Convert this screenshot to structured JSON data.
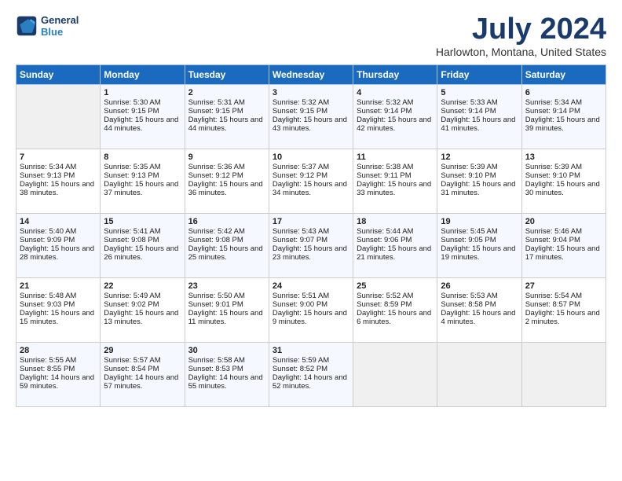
{
  "header": {
    "logo_line1": "General",
    "logo_line2": "Blue",
    "month_title": "July 2024",
    "location": "Harlowton, Montana, United States"
  },
  "days_of_week": [
    "Sunday",
    "Monday",
    "Tuesday",
    "Wednesday",
    "Thursday",
    "Friday",
    "Saturday"
  ],
  "weeks": [
    [
      {
        "day": "",
        "sunrise": "",
        "sunset": "",
        "daylight": ""
      },
      {
        "day": "1",
        "sunrise": "Sunrise: 5:30 AM",
        "sunset": "Sunset: 9:15 PM",
        "daylight": "Daylight: 15 hours and 44 minutes."
      },
      {
        "day": "2",
        "sunrise": "Sunrise: 5:31 AM",
        "sunset": "Sunset: 9:15 PM",
        "daylight": "Daylight: 15 hours and 44 minutes."
      },
      {
        "day": "3",
        "sunrise": "Sunrise: 5:32 AM",
        "sunset": "Sunset: 9:15 PM",
        "daylight": "Daylight: 15 hours and 43 minutes."
      },
      {
        "day": "4",
        "sunrise": "Sunrise: 5:32 AM",
        "sunset": "Sunset: 9:14 PM",
        "daylight": "Daylight: 15 hours and 42 minutes."
      },
      {
        "day": "5",
        "sunrise": "Sunrise: 5:33 AM",
        "sunset": "Sunset: 9:14 PM",
        "daylight": "Daylight: 15 hours and 41 minutes."
      },
      {
        "day": "6",
        "sunrise": "Sunrise: 5:34 AM",
        "sunset": "Sunset: 9:14 PM",
        "daylight": "Daylight: 15 hours and 39 minutes."
      }
    ],
    [
      {
        "day": "7",
        "sunrise": "Sunrise: 5:34 AM",
        "sunset": "Sunset: 9:13 PM",
        "daylight": "Daylight: 15 hours and 38 minutes."
      },
      {
        "day": "8",
        "sunrise": "Sunrise: 5:35 AM",
        "sunset": "Sunset: 9:13 PM",
        "daylight": "Daylight: 15 hours and 37 minutes."
      },
      {
        "day": "9",
        "sunrise": "Sunrise: 5:36 AM",
        "sunset": "Sunset: 9:12 PM",
        "daylight": "Daylight: 15 hours and 36 minutes."
      },
      {
        "day": "10",
        "sunrise": "Sunrise: 5:37 AM",
        "sunset": "Sunset: 9:12 PM",
        "daylight": "Daylight: 15 hours and 34 minutes."
      },
      {
        "day": "11",
        "sunrise": "Sunrise: 5:38 AM",
        "sunset": "Sunset: 9:11 PM",
        "daylight": "Daylight: 15 hours and 33 minutes."
      },
      {
        "day": "12",
        "sunrise": "Sunrise: 5:39 AM",
        "sunset": "Sunset: 9:10 PM",
        "daylight": "Daylight: 15 hours and 31 minutes."
      },
      {
        "day": "13",
        "sunrise": "Sunrise: 5:39 AM",
        "sunset": "Sunset: 9:10 PM",
        "daylight": "Daylight: 15 hours and 30 minutes."
      }
    ],
    [
      {
        "day": "14",
        "sunrise": "Sunrise: 5:40 AM",
        "sunset": "Sunset: 9:09 PM",
        "daylight": "Daylight: 15 hours and 28 minutes."
      },
      {
        "day": "15",
        "sunrise": "Sunrise: 5:41 AM",
        "sunset": "Sunset: 9:08 PM",
        "daylight": "Daylight: 15 hours and 26 minutes."
      },
      {
        "day": "16",
        "sunrise": "Sunrise: 5:42 AM",
        "sunset": "Sunset: 9:08 PM",
        "daylight": "Daylight: 15 hours and 25 minutes."
      },
      {
        "day": "17",
        "sunrise": "Sunrise: 5:43 AM",
        "sunset": "Sunset: 9:07 PM",
        "daylight": "Daylight: 15 hours and 23 minutes."
      },
      {
        "day": "18",
        "sunrise": "Sunrise: 5:44 AM",
        "sunset": "Sunset: 9:06 PM",
        "daylight": "Daylight: 15 hours and 21 minutes."
      },
      {
        "day": "19",
        "sunrise": "Sunrise: 5:45 AM",
        "sunset": "Sunset: 9:05 PM",
        "daylight": "Daylight: 15 hours and 19 minutes."
      },
      {
        "day": "20",
        "sunrise": "Sunrise: 5:46 AM",
        "sunset": "Sunset: 9:04 PM",
        "daylight": "Daylight: 15 hours and 17 minutes."
      }
    ],
    [
      {
        "day": "21",
        "sunrise": "Sunrise: 5:48 AM",
        "sunset": "Sunset: 9:03 PM",
        "daylight": "Daylight: 15 hours and 15 minutes."
      },
      {
        "day": "22",
        "sunrise": "Sunrise: 5:49 AM",
        "sunset": "Sunset: 9:02 PM",
        "daylight": "Daylight: 15 hours and 13 minutes."
      },
      {
        "day": "23",
        "sunrise": "Sunrise: 5:50 AM",
        "sunset": "Sunset: 9:01 PM",
        "daylight": "Daylight: 15 hours and 11 minutes."
      },
      {
        "day": "24",
        "sunrise": "Sunrise: 5:51 AM",
        "sunset": "Sunset: 9:00 PM",
        "daylight": "Daylight: 15 hours and 9 minutes."
      },
      {
        "day": "25",
        "sunrise": "Sunrise: 5:52 AM",
        "sunset": "Sunset: 8:59 PM",
        "daylight": "Daylight: 15 hours and 6 minutes."
      },
      {
        "day": "26",
        "sunrise": "Sunrise: 5:53 AM",
        "sunset": "Sunset: 8:58 PM",
        "daylight": "Daylight: 15 hours and 4 minutes."
      },
      {
        "day": "27",
        "sunrise": "Sunrise: 5:54 AM",
        "sunset": "Sunset: 8:57 PM",
        "daylight": "Daylight: 15 hours and 2 minutes."
      }
    ],
    [
      {
        "day": "28",
        "sunrise": "Sunrise: 5:55 AM",
        "sunset": "Sunset: 8:55 PM",
        "daylight": "Daylight: 14 hours and 59 minutes."
      },
      {
        "day": "29",
        "sunrise": "Sunrise: 5:57 AM",
        "sunset": "Sunset: 8:54 PM",
        "daylight": "Daylight: 14 hours and 57 minutes."
      },
      {
        "day": "30",
        "sunrise": "Sunrise: 5:58 AM",
        "sunset": "Sunset: 8:53 PM",
        "daylight": "Daylight: 14 hours and 55 minutes."
      },
      {
        "day": "31",
        "sunrise": "Sunrise: 5:59 AM",
        "sunset": "Sunset: 8:52 PM",
        "daylight": "Daylight: 14 hours and 52 minutes."
      },
      {
        "day": "",
        "sunrise": "",
        "sunset": "",
        "daylight": ""
      },
      {
        "day": "",
        "sunrise": "",
        "sunset": "",
        "daylight": ""
      },
      {
        "day": "",
        "sunrise": "",
        "sunset": "",
        "daylight": ""
      }
    ]
  ]
}
